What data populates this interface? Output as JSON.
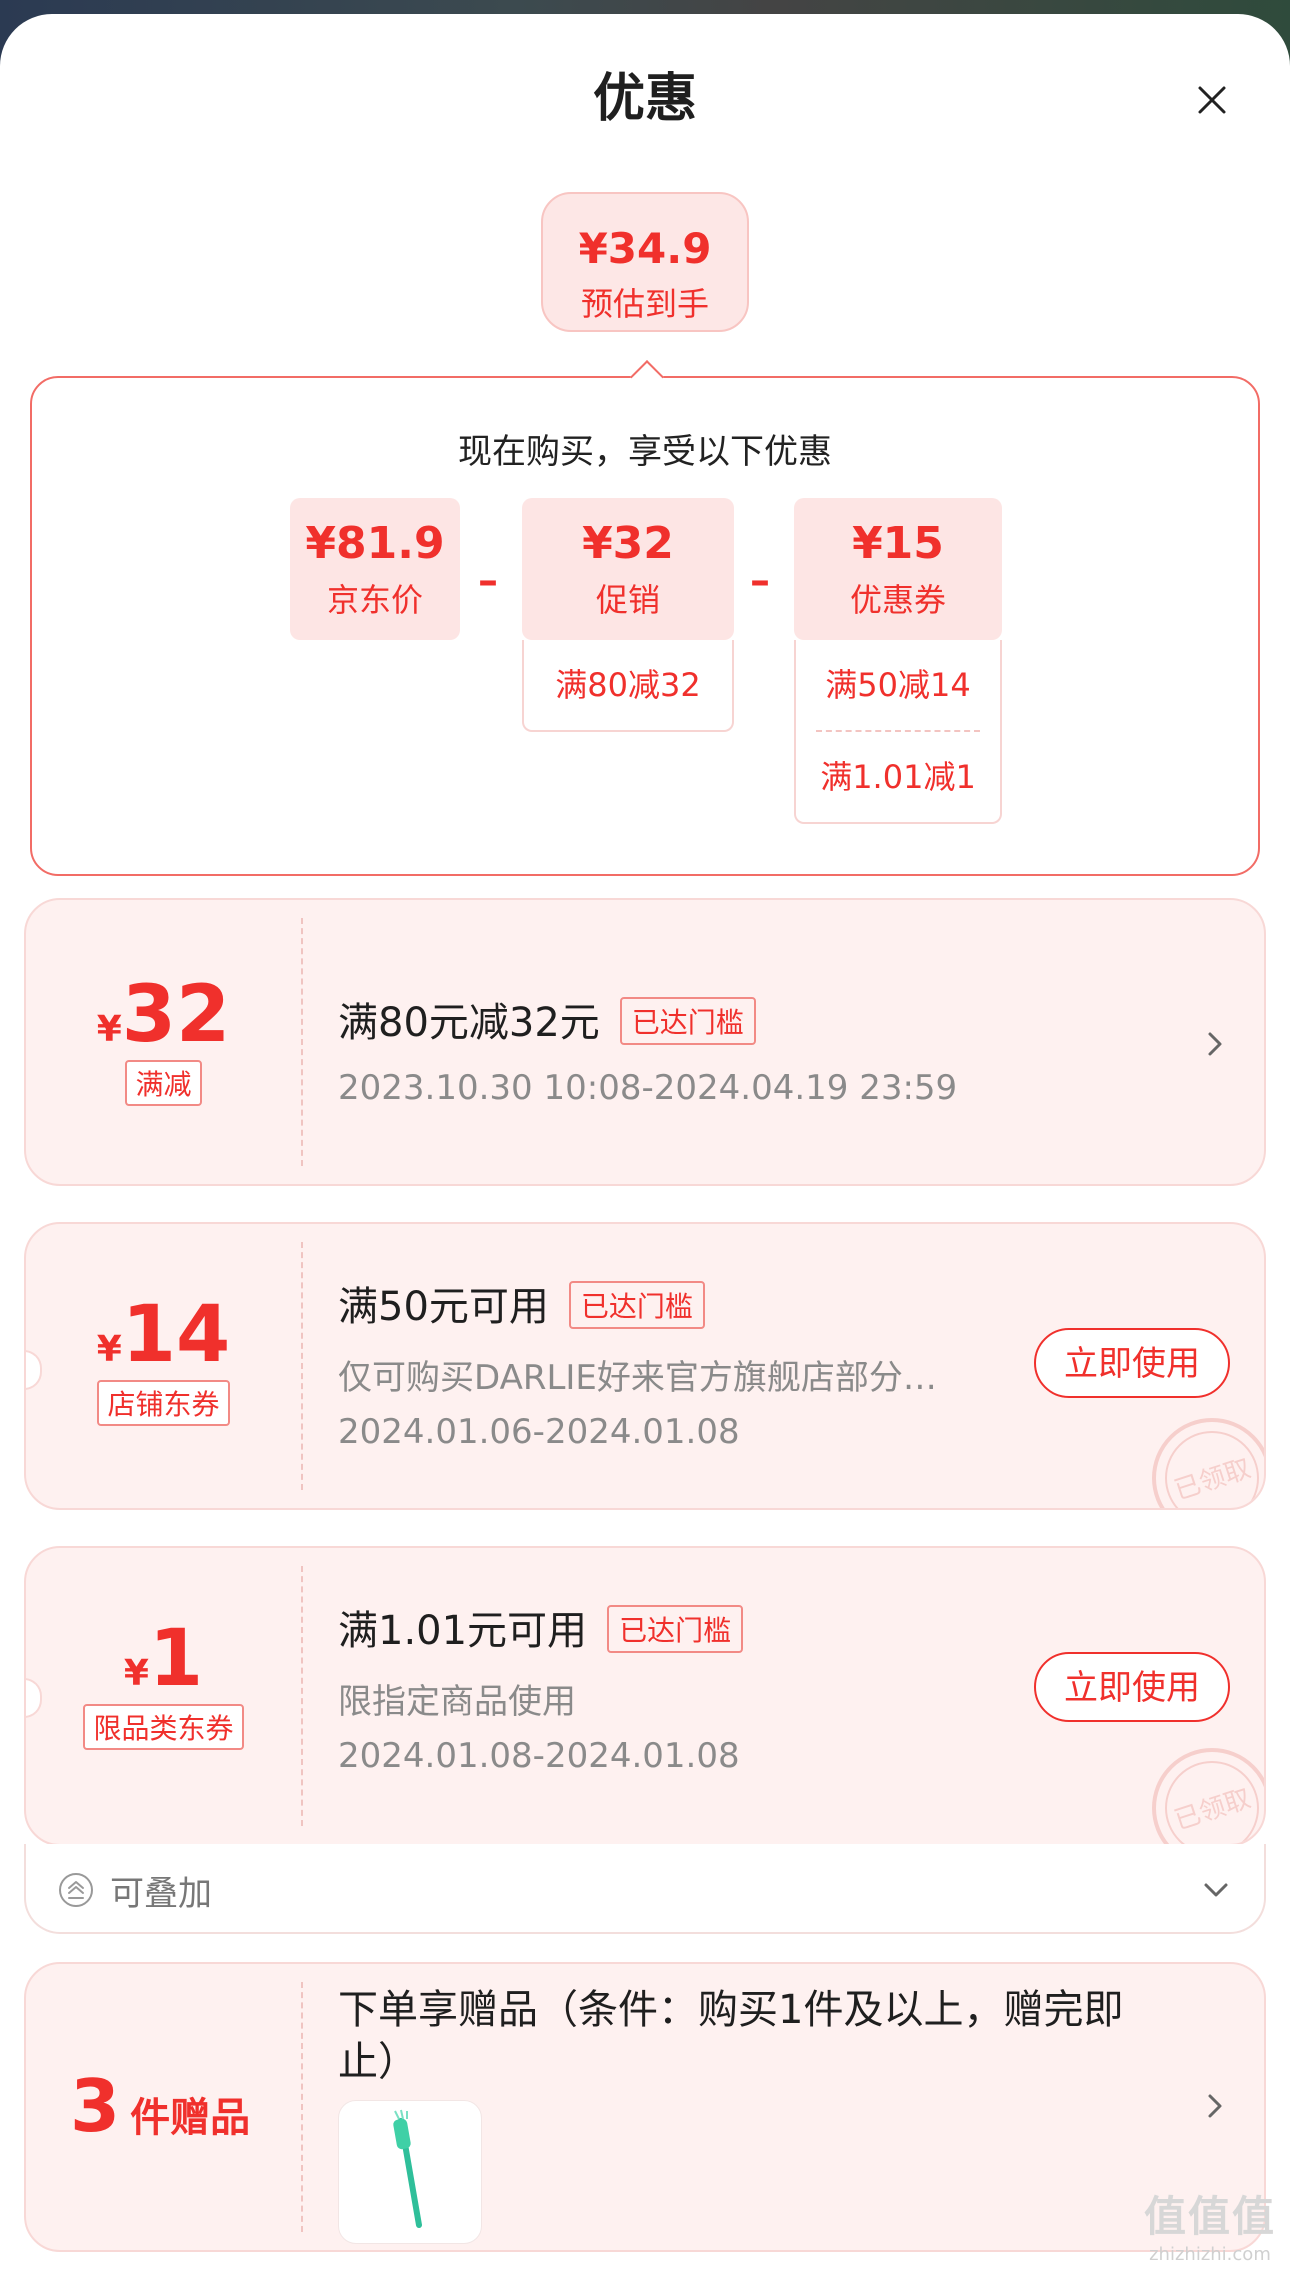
{
  "header": {
    "title": "优惠",
    "close_icon": "close-icon"
  },
  "estimate": {
    "value": "¥34.9",
    "label": "预估到手"
  },
  "breakdown": {
    "heading": "现在购买，享受以下优惠",
    "minus": "–",
    "jd_price": {
      "value": "¥81.9",
      "label": "京东价"
    },
    "promo": {
      "value": "¥32",
      "label": "促销",
      "details": [
        "满80减32"
      ]
    },
    "coupon": {
      "value": "¥15",
      "label": "优惠券",
      "details": [
        "满50减14",
        "满1.01减1"
      ]
    }
  },
  "coupons": [
    {
      "currency": "¥",
      "amount": "32",
      "type": "满减",
      "title": "满80元减32元",
      "badge": "已达门槛",
      "date": "2023.10.30 10:08-2024.04.19 23:59"
    },
    {
      "currency": "¥",
      "amount": "14",
      "type": "店铺东券",
      "title": "满50元可用",
      "badge": "已达门槛",
      "desc": "仅可购买DARLIE好来官方旗舰店部分…",
      "date": "2024.01.06-2024.01.08",
      "action": "立即使用",
      "stamp": "已领取"
    },
    {
      "currency": "¥",
      "amount": "1",
      "type": "限品类东券",
      "title": "满1.01元可用",
      "badge": "已达门槛",
      "desc": "限指定商品使用",
      "date": "2024.01.08-2024.01.08",
      "action": "立即使用",
      "stamp": "已领取"
    }
  ],
  "stack": {
    "label": "可叠加"
  },
  "gift": {
    "count": "3",
    "unit": "件赠品",
    "title": "下单享赠品（条件：购买1件及以上，赠完即止）"
  },
  "watermark": {
    "glyphs": "值值值",
    "site": "zhizhizhi.com"
  },
  "colors": {
    "accent": "#f0302c",
    "card_bg": "#fef1f0",
    "border": "#f26c66"
  }
}
